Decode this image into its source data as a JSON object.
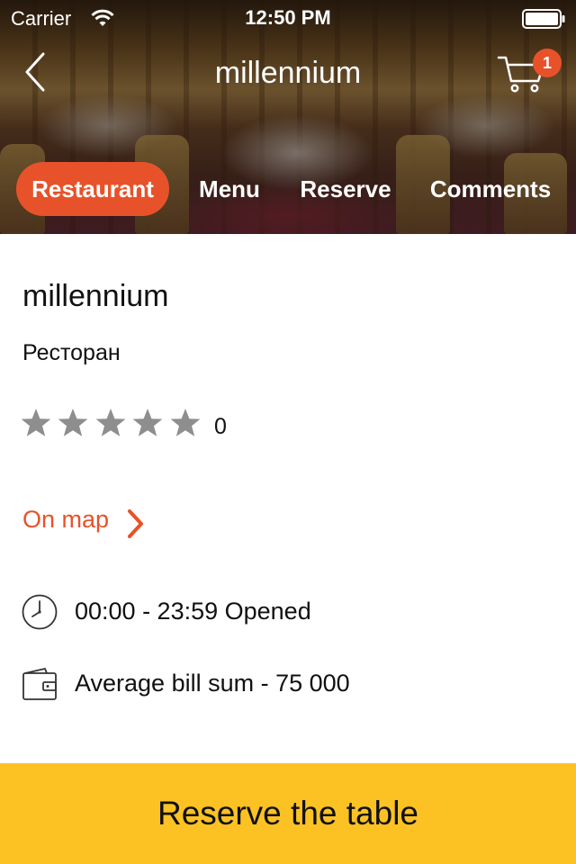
{
  "status_bar": {
    "carrier": "Carrier",
    "time": "12:50 PM",
    "icons": [
      "wifi-icon",
      "battery-icon"
    ]
  },
  "nav": {
    "title": "millennium",
    "back_icon": "chevron-left-icon",
    "cart_icon": "cart-icon",
    "cart_badge_count": "1"
  },
  "tabs": [
    {
      "label": "Restaurant",
      "active": true
    },
    {
      "label": "Menu",
      "active": false
    },
    {
      "label": "Reserve",
      "active": false
    },
    {
      "label": "Comments",
      "active": false
    }
  ],
  "restaurant": {
    "name": "millennium",
    "type": "Ресторан",
    "rating": {
      "stars_filled": 0,
      "stars_total": 5,
      "count": "0"
    },
    "map_link": "On map",
    "hours": "00:00 - 23:59 Opened",
    "average_bill": "Average bill sum - 75 000"
  },
  "cta": {
    "label": "Reserve the table"
  },
  "colors": {
    "accent": "#e8522a",
    "cta_background": "#fcc224",
    "star_empty": "#8e8e8e"
  }
}
